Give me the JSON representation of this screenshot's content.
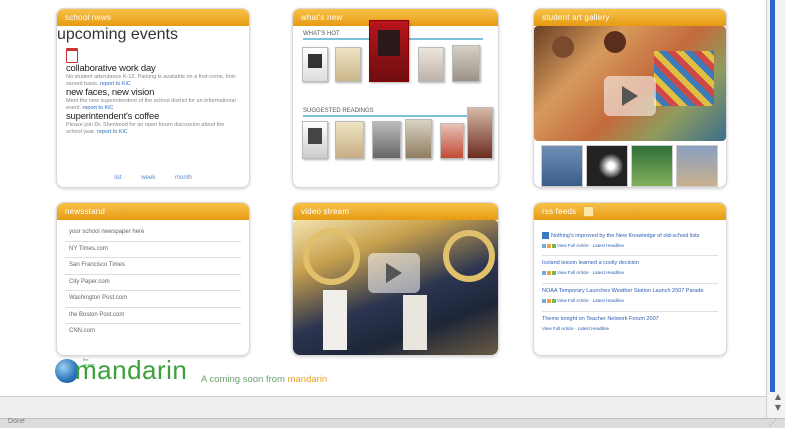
{
  "tabs": {
    "school_news": "school news",
    "upcoming_events": "upcoming events",
    "whats_new": "what's new",
    "student_art_gallery": "student art gallery",
    "newsstand": "newsstand",
    "video_stream": "video stream",
    "rss_feeds": "rss feeds"
  },
  "news": {
    "items": [
      {
        "title": "collaborative work day",
        "text": "No student attendance K-12. Parking is available on a first-come, first-served basis.",
        "link": "report to KiC"
      },
      {
        "title": "new faces, new vision",
        "text": "Meet the new superintendent of the school district for an informational event.",
        "link": "report to KiC"
      },
      {
        "title": "superintendent's coffee",
        "text": "Please join Dr. Sherwood for an open forum discussion about the school year.",
        "link": "report to KiC"
      }
    ],
    "links": [
      "list",
      "week",
      "month"
    ]
  },
  "whats_new": {
    "hot_label": "WHAT'S HOT",
    "suggested_label": "SUGGESTED READINGS"
  },
  "newsstand": {
    "items": [
      "your school newspaper here",
      "NY Times.com",
      "San Francisco Times",
      "City Paper.com",
      "Washington Post.com",
      "the Boston Post.com",
      "CNN.com"
    ]
  },
  "rss": {
    "items": [
      {
        "title": "Nothing's improved by the New Knowledge of old-school lists",
        "meta": "View Full Article · Latest Headline"
      },
      {
        "title": "Iceland lesson learned a costly decision",
        "meta": "View Full Article · Latest Headline"
      },
      {
        "title": "NOAA Temporary Launches Weather Station Launch 2007 Parade",
        "meta": "View Full Article · Latest Headline"
      },
      {
        "title": "Theme tonight on Teacher Network Forum 2007",
        "meta": "View Full Article · Latest Headline"
      }
    ]
  },
  "footer": {
    "brand": "mandarin",
    "brand_prefix": "the mobile",
    "tagline_prefix": "A coming soon from",
    "tagline_brand": "mandarin"
  },
  "status": {
    "text": "Done"
  },
  "colors": {
    "header_orange": "#f0a82b",
    "brand_green": "#3aa23a",
    "link_blue": "#2c6cc0"
  }
}
